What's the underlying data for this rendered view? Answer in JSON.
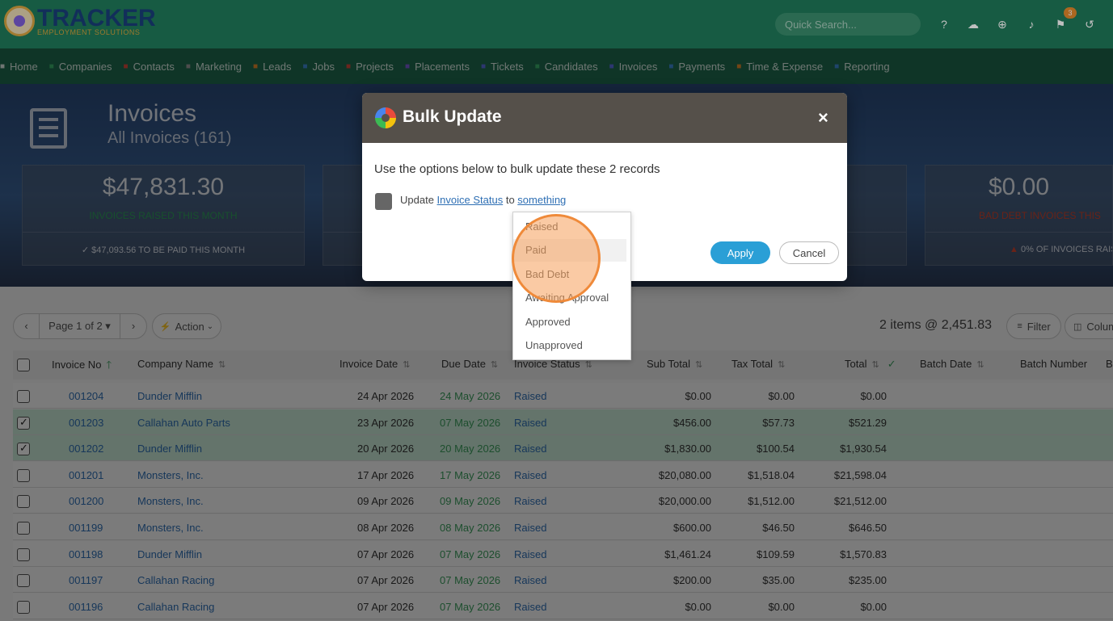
{
  "app": {
    "logo_main": "TRACKER",
    "logo_sub": "EMPLOYMENT SOLUTIONS",
    "search_placeholder": "Quick Search...",
    "notification_count": "3",
    "icons": [
      "help-icon",
      "chat-icon",
      "add-icon",
      "bell-icon",
      "flag-icon",
      "history-icon"
    ]
  },
  "nav": [
    {
      "label": "Home",
      "icon": "home-icon",
      "color": "#e0ece6"
    },
    {
      "label": "Companies",
      "icon": "companies-icon",
      "color": "#3bb36b"
    },
    {
      "label": "Contacts",
      "icon": "contacts-icon",
      "color": "#d94a3b"
    },
    {
      "label": "Marketing",
      "icon": "marketing-icon",
      "color": "#9b9b9b"
    },
    {
      "label": "Leads",
      "icon": "leads-icon",
      "color": "#e68a2b"
    },
    {
      "label": "Jobs",
      "icon": "jobs-icon",
      "color": "#3f8ad6"
    },
    {
      "label": "Projects",
      "icon": "projects-icon",
      "color": "#d94a3b"
    },
    {
      "label": "Placements",
      "icon": "placements-icon",
      "color": "#7b5cd6"
    },
    {
      "label": "Tickets",
      "icon": "tickets-icon",
      "color": "#5b6ee0"
    },
    {
      "label": "Candidates",
      "icon": "candidates-icon",
      "color": "#3bb36b"
    },
    {
      "label": "Invoices",
      "icon": "invoices-icon",
      "color": "#5b6ee0"
    },
    {
      "label": "Payments",
      "icon": "payments-icon",
      "color": "#3f8ad6"
    },
    {
      "label": "Time & Expense",
      "icon": "time-icon",
      "color": "#e68a2b"
    },
    {
      "label": "Reporting",
      "icon": "reporting-icon",
      "color": "#3f8ad6"
    }
  ],
  "header": {
    "title": "Invoices",
    "subtitle": "All Invoices (161)"
  },
  "cards": [
    {
      "amount": "$47,831.30",
      "label": "INVOICES RAISED THIS MONTH",
      "label_color": "#2fa05a",
      "footer": "$47,093.56 TO BE PAID THIS MONTH"
    },
    {
      "amount": "$0.00",
      "label": "BAD DEBT INVOICES THIS",
      "label_color": "#d2452f",
      "footer": "0% OF INVOICES RAIS"
    }
  ],
  "toolbar": {
    "prev": "‹",
    "page": "Page 1 of 2",
    "next": "›",
    "action": "Action",
    "items": "2 items @ 2,451.83",
    "filter": "Filter",
    "columns": "Colum"
  },
  "columns": [
    "Invoice No",
    "Company Name",
    "Invoice Date",
    "Due Date",
    "Invoice Status",
    "Sub Total",
    "Tax Total",
    "Total",
    "Batch Date",
    "Batch Number",
    "B"
  ],
  "rows": [
    {
      "no": "001204",
      "company": "Dunder Mifflin",
      "inv_date": "24 Apr 2026",
      "due": "24 May 2026",
      "status": "Raised",
      "sub": "$0.00",
      "tax": "$0.00",
      "total": "$0.00",
      "checked": false
    },
    {
      "no": "001203",
      "company": "Callahan Auto Parts",
      "inv_date": "23 Apr 2026",
      "due": "07 May 2026",
      "status": "Raised",
      "sub": "$456.00",
      "tax": "$57.73",
      "total": "$521.29",
      "checked": true
    },
    {
      "no": "001202",
      "company": "Dunder Mifflin",
      "inv_date": "20 Apr 2026",
      "due": "20 May 2026",
      "status": "Raised",
      "sub": "$1,830.00",
      "tax": "$100.54",
      "total": "$1,930.54",
      "checked": true
    },
    {
      "no": "001201",
      "company": "Monsters, Inc.",
      "inv_date": "17 Apr 2026",
      "due": "17 May 2026",
      "status": "Raised",
      "sub": "$20,080.00",
      "tax": "$1,518.04",
      "total": "$21,598.04",
      "checked": false
    },
    {
      "no": "001200",
      "company": "Monsters, Inc.",
      "inv_date": "09 Apr 2026",
      "due": "09 May 2026",
      "status": "Raised",
      "sub": "$20,000.00",
      "tax": "$1,512.00",
      "total": "$21,512.00",
      "checked": false
    },
    {
      "no": "001199",
      "company": "Monsters, Inc.",
      "inv_date": "08 Apr 2026",
      "due": "08 May 2026",
      "status": "Raised",
      "sub": "$600.00",
      "tax": "$46.50",
      "total": "$646.50",
      "checked": false
    },
    {
      "no": "001198",
      "company": "Dunder Mifflin",
      "inv_date": "07 Apr 2026",
      "due": "07 May 2026",
      "status": "Raised",
      "sub": "$1,461.24",
      "tax": "$109.59",
      "total": "$1,570.83",
      "checked": false
    },
    {
      "no": "001197",
      "company": "Callahan Racing",
      "inv_date": "07 Apr 2026",
      "due": "07 May 2026",
      "status": "Raised",
      "sub": "$200.00",
      "tax": "$35.00",
      "total": "$235.00",
      "checked": false
    },
    {
      "no": "001196",
      "company": "Callahan Racing",
      "inv_date": "07 Apr 2026",
      "due": "07 May 2026",
      "status": "Raised",
      "sub": "$0.00",
      "tax": "$0.00",
      "total": "$0.00",
      "checked": false
    }
  ],
  "modal": {
    "title": "Bulk Update",
    "close": "×",
    "description": "Use the options below to bulk update these 2 records",
    "line_prefix": "Update",
    "field_link": "Invoice Status",
    "line_mid": "to",
    "value_link": "something",
    "apply": "Apply",
    "cancel": "Cancel"
  },
  "dropdown": {
    "options": [
      "Raised",
      "Paid",
      "Bad Debt",
      "Awaiting Approval",
      "Approved",
      "Unapproved"
    ],
    "hovered": "Paid"
  }
}
